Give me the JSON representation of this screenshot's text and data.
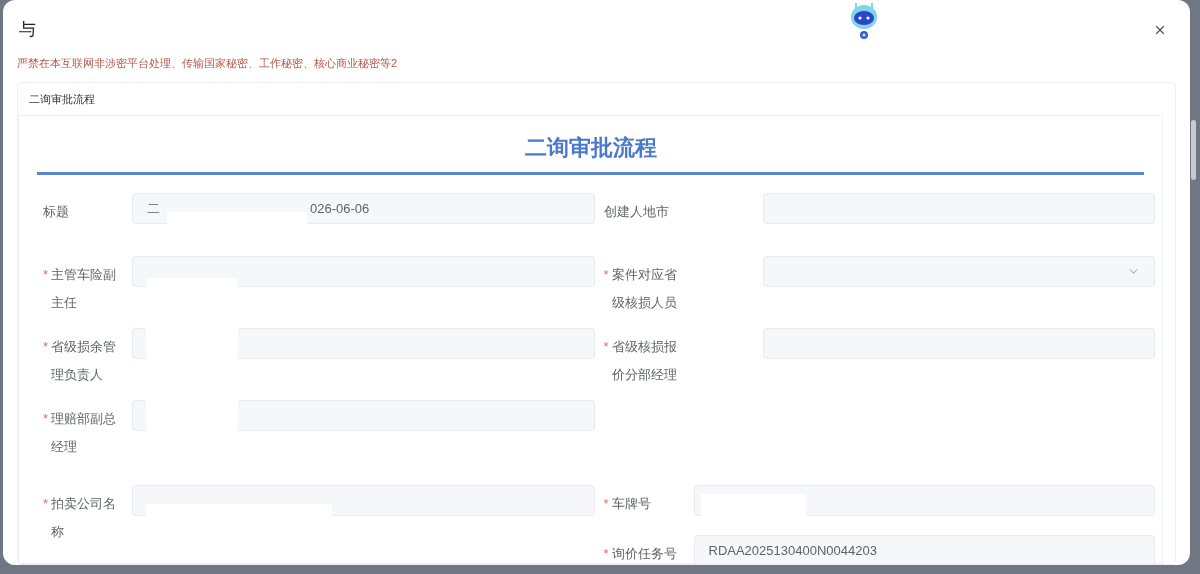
{
  "dialog": {
    "title": "与",
    "warning": "严禁在本互联网非涉密平台处理、传输国家秘密、工作秘密、核心商业秘密等2"
  },
  "section_tab": "二询审批流程",
  "required_marker": "*",
  "form": {
    "heading": "二询审批流程",
    "rows": [
      {
        "left": {
          "kind": "text",
          "label": "标题",
          "required": false,
          "value_parts": [
            "二",
            "026-06-06"
          ]
        },
        "right": {
          "kind": "text",
          "label": "创建人地市",
          "required": false
        }
      },
      {
        "left": {
          "kind": "text",
          "label": "主管车险副主任",
          "required": true
        },
        "right": {
          "kind": "select",
          "label": "案件对应省级核损人员",
          "required": true
        }
      },
      {
        "left": {
          "kind": "text",
          "label": "省级损余管理负责人",
          "required": true
        },
        "right": {
          "kind": "text",
          "label": "省级核损报价分部经理",
          "required": true
        }
      },
      {
        "left": {
          "kind": "text",
          "label": "理赔部副总经理",
          "required": true
        }
      },
      {
        "left": {
          "kind": "text",
          "label": "拍卖公司名称",
          "required": true
        },
        "right": {
          "kind": "text",
          "label": "车牌号",
          "required": true
        }
      },
      {
        "right": {
          "kind": "text",
          "label": "询价任务号",
          "required": true,
          "value_parts": [
            "RDAA2025130400N0044203"
          ]
        }
      }
    ]
  }
}
